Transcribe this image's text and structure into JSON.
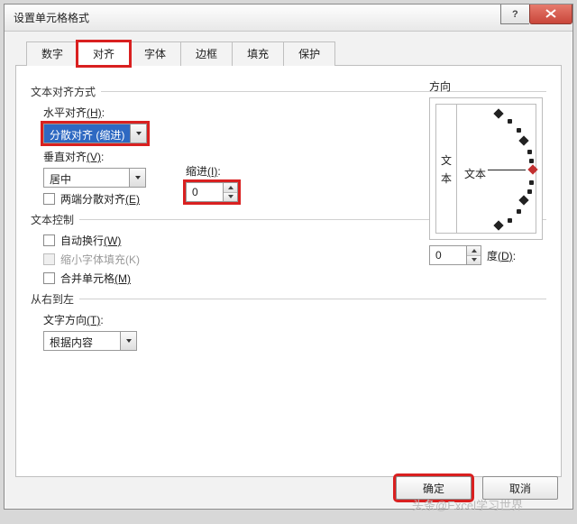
{
  "window": {
    "title": "设置单元格格式"
  },
  "tabs": {
    "items": [
      "数字",
      "对齐",
      "字体",
      "边框",
      "填充",
      "保护"
    ],
    "active": 1
  },
  "sections": {
    "textAlign": "文本对齐方式",
    "textControl": "文本控制",
    "rtl": "从右到左",
    "orientation": "方向"
  },
  "align": {
    "horizontalLabelPrefix": "水平对齐",
    "horizontalHotkey": "(H)",
    "horizontalValue": "分散对齐 (缩进)",
    "indentLabelPrefix": "缩进",
    "indentHotkey": "(I)",
    "indentValue": "0",
    "verticalLabelPrefix": "垂直对齐",
    "verticalHotkey": "(V)",
    "verticalValue": "居中"
  },
  "checks": {
    "justifyPrefix": "两端分散对齐",
    "justifyHotkey": "(E)",
    "wrapPrefix": "自动换行",
    "wrapHotkey": "(W)",
    "shrinkPrefix": "缩小字体填充",
    "shrinkHotkey": "(K)",
    "mergePrefix": "合并单元格",
    "mergeHotkey": "(M)"
  },
  "rtl": {
    "labelPrefix": "文字方向",
    "labelHotkey": "(T)",
    "value": "根据内容"
  },
  "orientation": {
    "vertText1": "文",
    "vertText2": "本",
    "horizText": "文本",
    "degreesValue": "0",
    "degreesLabelPrefix": "度",
    "degreesHotkey": "(D)"
  },
  "buttons": {
    "ok": "确定",
    "cancel": "取消"
  },
  "watermark": "头条@Excel学习世界"
}
